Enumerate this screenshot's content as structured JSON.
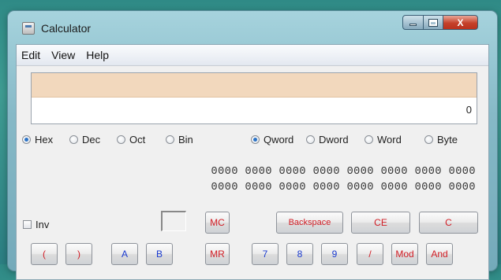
{
  "window": {
    "title": "Calculator",
    "controls": {
      "minimize": "minimize",
      "maximize": "maximize",
      "close": "X"
    }
  },
  "menu": [
    "Edit",
    "View",
    "Help"
  ],
  "display": {
    "value": "0"
  },
  "base_options": [
    {
      "label": "Hex",
      "checked": true
    },
    {
      "label": "Dec",
      "checked": false
    },
    {
      "label": "Oct",
      "checked": false
    },
    {
      "label": "Bin",
      "checked": false
    }
  ],
  "word_options": [
    {
      "label": "Qword",
      "checked": true
    },
    {
      "label": "Dword",
      "checked": false
    },
    {
      "label": "Word",
      "checked": false
    },
    {
      "label": "Byte",
      "checked": false
    }
  ],
  "bit_rows": [
    "0000 0000 0000 0000 0000 0000 0000 0000",
    "0000 0000 0000 0000 0000 0000 0000 0000"
  ],
  "inv": {
    "label": "Inv",
    "checked": false
  },
  "buttons": {
    "mc": "MC",
    "backspace": "Backspace",
    "ce": "CE",
    "c": "C",
    "lparen": "(",
    "rparen": ")",
    "a": "A",
    "b": "B",
    "mr": "MR",
    "seven": "7",
    "eight": "8",
    "nine": "9",
    "divide": "/",
    "mod": "Mod",
    "and": "And"
  },
  "colors": {
    "operator_text": "#d11c24",
    "digit_text": "#1a3ad0",
    "memory_strip": "#f2d8bd"
  }
}
